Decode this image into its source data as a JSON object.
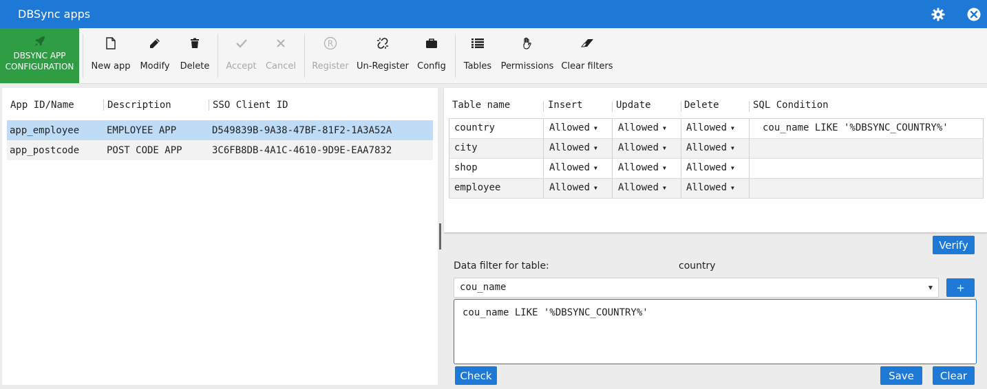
{
  "window": {
    "title": "DBSync apps"
  },
  "icons": {
    "settings": "gear-icon",
    "close": "close-icon"
  },
  "toolbar": {
    "app_config_label_1": "DBSYNC APP",
    "app_config_label_2": "CONFIGURATION",
    "new_app": "New app",
    "modify": "Modify",
    "delete": "Delete",
    "accept": "Accept",
    "cancel": "Cancel",
    "register": "Register",
    "unregister": "Un-Register",
    "config": "Config",
    "tables": "Tables",
    "permissions": "Permissions",
    "clear_filters": "Clear filters"
  },
  "apps_grid": {
    "headers": [
      "App ID/Name",
      "Description",
      "SSO Client ID"
    ],
    "rows": [
      {
        "id": "app_employee",
        "description": "EMPLOYEE APP",
        "sso": "D549839B-9A38-47BF-81F2-1A3A52A",
        "selected": true
      },
      {
        "id": "app_postcode",
        "description": "POST CODE APP",
        "sso": "3C6FB8DB-4A1C-4610-9D9E-EAA7832",
        "selected": false
      }
    ]
  },
  "tables_grid": {
    "headers": [
      "Table name",
      "Insert",
      "Update",
      "Delete",
      "SQL Condition"
    ],
    "rows": [
      {
        "name": "country",
        "insert": "Allowed",
        "update": "Allowed",
        "delete": "Allowed",
        "sql": "cou_name LIKE '%DBSYNC_COUNTRY%'"
      },
      {
        "name": "city",
        "insert": "Allowed",
        "update": "Allowed",
        "delete": "Allowed",
        "sql": ""
      },
      {
        "name": "shop",
        "insert": "Allowed",
        "update": "Allowed",
        "delete": "Allowed",
        "sql": ""
      },
      {
        "name": "employee",
        "insert": "Allowed",
        "update": "Allowed",
        "delete": "Allowed",
        "sql": ""
      }
    ]
  },
  "filter": {
    "verify": "Verify",
    "label": "Data filter for table:",
    "table": "country",
    "column": "cou_name",
    "add": "+",
    "condition": "cou_name LIKE '%DBSYNC_COUNTRY%'",
    "check": "Check",
    "save": "Save",
    "clear": "Clear"
  },
  "colors": {
    "accent": "#1e78d6",
    "app_config_bg": "#2e9d44",
    "selected_row": "#bfdcf7"
  }
}
